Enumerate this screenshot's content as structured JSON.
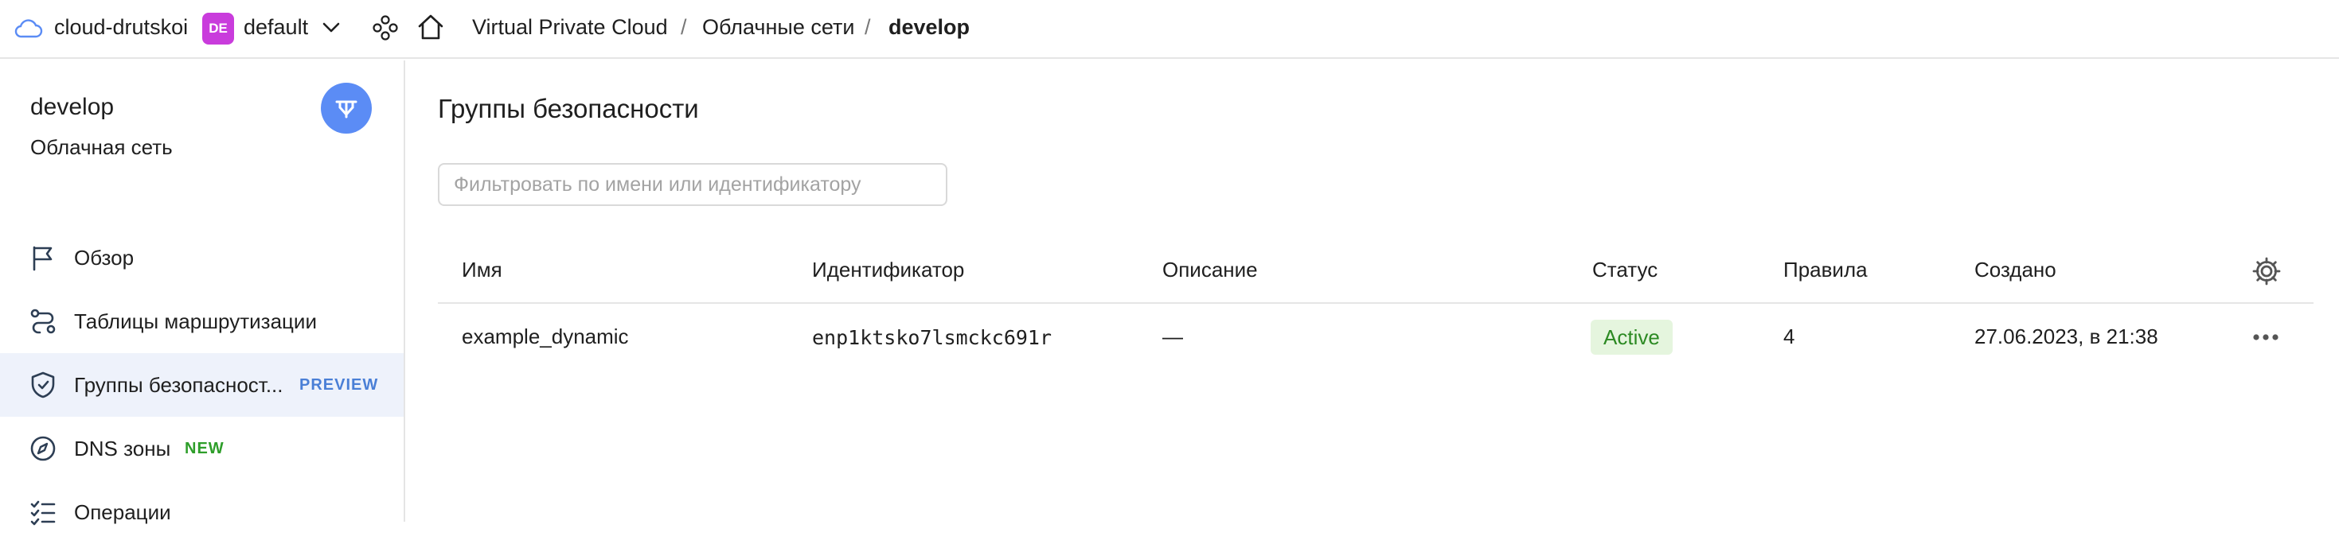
{
  "topbar": {
    "cloud_name": "cloud-drutskoi",
    "folder_badge": "DE",
    "folder_name": "default",
    "breadcrumbs": [
      "Virtual Private Cloud",
      "Облачные сети",
      "develop"
    ],
    "separator": "/"
  },
  "sidebar": {
    "title": "develop",
    "subtitle": "Облачная сеть",
    "items": [
      {
        "label": "Обзор",
        "icon": "flag-icon"
      },
      {
        "label": "Таблицы маршрутизации",
        "icon": "route-icon"
      },
      {
        "label": "Группы безопасност...",
        "icon": "shield-icon",
        "tag": "PREVIEW",
        "active": true
      },
      {
        "label": "DNS зоны",
        "icon": "compass-icon",
        "tag": "NEW"
      },
      {
        "label": "Операции",
        "icon": "checklist-icon"
      }
    ]
  },
  "main": {
    "title": "Группы безопасности",
    "filter_placeholder": "Фильтровать по имени или идентификатору",
    "columns": [
      "Имя",
      "Идентификатор",
      "Описание",
      "Статус",
      "Правила",
      "Создано"
    ],
    "rows": [
      {
        "name": "example_dynamic",
        "id": "enp1ktsko7lsmckc691r",
        "description": "—",
        "status": "Active",
        "rules": "4",
        "created": "27.06.2023, в 21:38"
      }
    ]
  },
  "colors": {
    "accent_blue": "#5b8cf5",
    "preview_tag": "#4a7fd6",
    "new_tag": "#2e9e2a",
    "status_bg": "#e5f5de",
    "status_text": "#2c8a23",
    "folder_badge": "#c93cdc"
  }
}
